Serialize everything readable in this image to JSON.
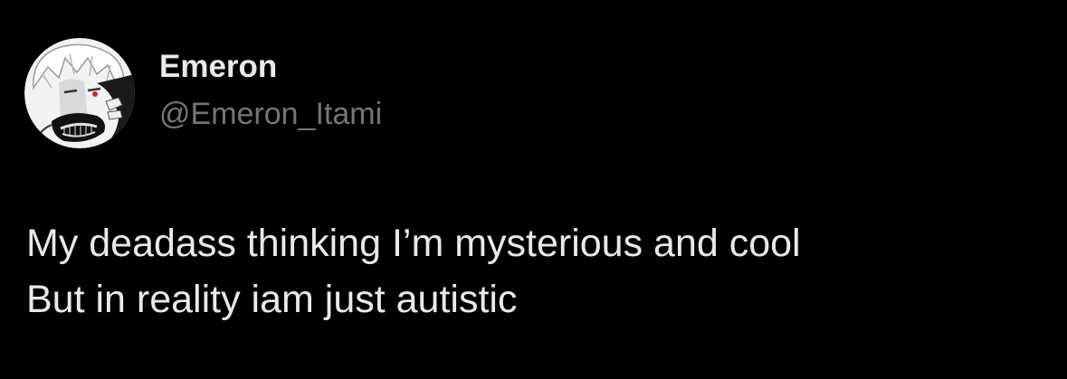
{
  "colors": {
    "background": "#000000",
    "name_text": "#e7e9ea",
    "handle_text": "#71767b",
    "body_text": "#e7e9ea"
  },
  "author": {
    "display_name": "Emeron",
    "handle": "@Emeron_Itami",
    "avatar_icon": "anime-character-avatar"
  },
  "tweet": {
    "lines": [
      "My deadass thinking I’m mysterious and cool",
      "But in reality iam just autistic"
    ]
  }
}
